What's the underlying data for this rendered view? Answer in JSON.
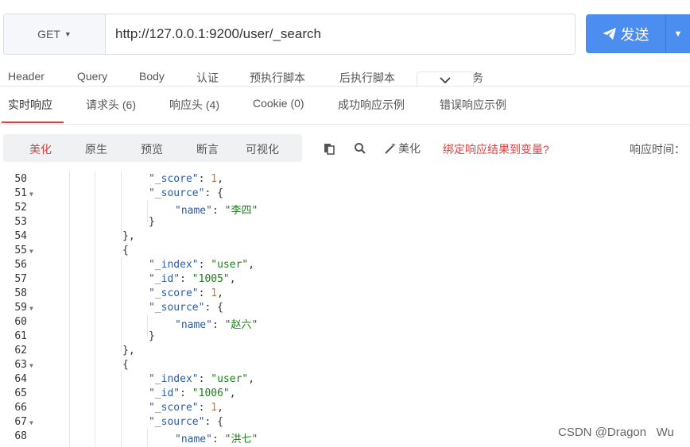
{
  "request": {
    "method": "GET",
    "url": "http://127.0.0.1:9200/user/_search",
    "send_label": "发送"
  },
  "request_tabs": [
    "Header",
    "Query",
    "Body",
    "认证",
    "预执行脚本",
    "后执行脚本",
    "务"
  ],
  "response_tabs": [
    "实时响应",
    "请求头 (6)",
    "响应头 (4)",
    "Cookie (0)",
    "成功响应示例",
    "错误响应示例"
  ],
  "view_modes": [
    "美化",
    "原生",
    "预览",
    "断言",
    "可视化"
  ],
  "tools": {
    "beautify_label": "美化",
    "bind_variable_label": "绑定响应结果到变量?",
    "response_time_label": "响应时间："
  },
  "code_lines": [
    {
      "num": "50",
      "fold": false
    },
    {
      "num": "51",
      "fold": true
    },
    {
      "num": "52",
      "fold": false
    },
    {
      "num": "53",
      "fold": false
    },
    {
      "num": "54",
      "fold": false
    },
    {
      "num": "55",
      "fold": true
    },
    {
      "num": "56",
      "fold": false
    },
    {
      "num": "57",
      "fold": false
    },
    {
      "num": "58",
      "fold": false
    },
    {
      "num": "59",
      "fold": true
    },
    {
      "num": "60",
      "fold": false
    },
    {
      "num": "61",
      "fold": false
    },
    {
      "num": "62",
      "fold": false
    },
    {
      "num": "63",
      "fold": true
    },
    {
      "num": "64",
      "fold": false
    },
    {
      "num": "65",
      "fold": false
    },
    {
      "num": "66",
      "fold": false
    },
    {
      "num": "67",
      "fold": true
    },
    {
      "num": "68",
      "fold": false
    }
  ],
  "code": {
    "l50": {
      "a": "\"_score\"",
      "b": ": ",
      "c": "1",
      "d": ","
    },
    "l51": {
      "a": "\"_source\"",
      "b": ": {"
    },
    "l52": {
      "a": "\"name\"",
      "b": ": ",
      "c": "\"李四\""
    },
    "l53": {
      "a": "}"
    },
    "l54": {
      "a": "},"
    },
    "l55": {
      "a": "{"
    },
    "l56": {
      "a": "\"_index\"",
      "b": ": ",
      "c": "\"user\"",
      "d": ","
    },
    "l57": {
      "a": "\"_id\"",
      "b": ": ",
      "c": "\"1005\"",
      "d": ","
    },
    "l58": {
      "a": "\"_score\"",
      "b": ": ",
      "c": "1",
      "d": ","
    },
    "l59": {
      "a": "\"_source\"",
      "b": ": {"
    },
    "l60": {
      "a": "\"name\"",
      "b": ": ",
      "c": "\"赵六\""
    },
    "l61": {
      "a": "}"
    },
    "l62": {
      "a": "},"
    },
    "l63": {
      "a": "{"
    },
    "l64": {
      "a": "\"_index\"",
      "b": ": ",
      "c": "\"user\"",
      "d": ","
    },
    "l65": {
      "a": "\"_id\"",
      "b": ": ",
      "c": "\"1006\"",
      "d": ","
    },
    "l66": {
      "a": "\"_score\"",
      "b": ": ",
      "c": "1",
      "d": ","
    },
    "l67": {
      "a": "\"_source\"",
      "b": ": {"
    },
    "l68": {
      "a": "\"name\"",
      "b": ": ",
      "c": "\"洪七\""
    }
  },
  "watermark": "CSDN @Dragon   Wu",
  "colors": {
    "send_button": "#4b8ef0",
    "active_accent": "#e04040",
    "json_key": "#2c5c9e",
    "json_string": "#1a7f1a",
    "json_number": "#e2711d"
  },
  "icons": [
    "paper-plane-icon",
    "caret-down-icon",
    "chevron-down-icon",
    "copy-icon",
    "search-icon",
    "magic-wand-icon",
    "fold-arrow-icon"
  ]
}
